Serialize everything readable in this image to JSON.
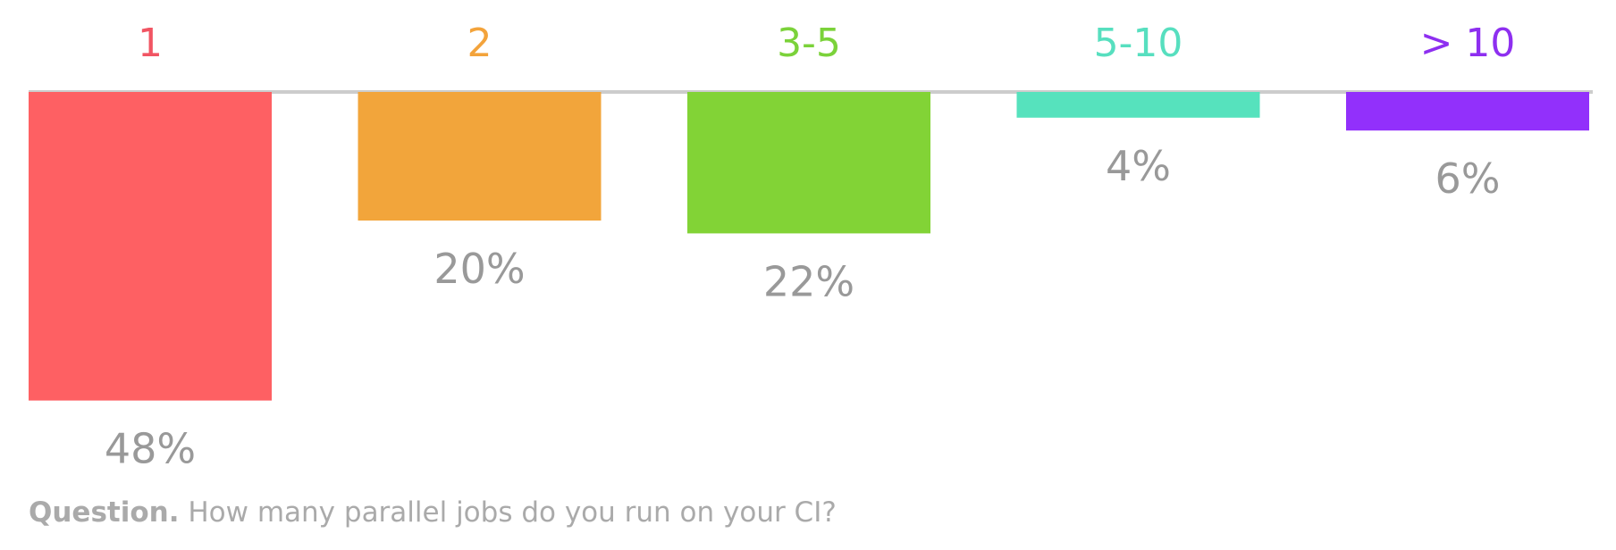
{
  "chart_data": {
    "type": "bar",
    "orientation": "downward",
    "categories": [
      "1",
      "2",
      "3-5",
      "5-10",
      "> 10"
    ],
    "values": [
      48,
      20,
      22,
      4,
      6
    ],
    "value_labels": [
      "48%",
      "20%",
      "22%",
      "4%",
      "6%"
    ],
    "unit": "%",
    "colors": [
      "#fe6063",
      "#f2a53b",
      "#82d336",
      "#56e2bd",
      "#9230fb"
    ],
    "label_colors": [
      "#f15563",
      "#f3a33b",
      "#7bd23a",
      "#57dfbf",
      "#8e2ff0"
    ],
    "baseline_color": "#cccccc",
    "grid": false,
    "legend": "none"
  },
  "question": {
    "prefix": "Question.",
    "text": "How many parallel jobs do you run on your CI?"
  }
}
